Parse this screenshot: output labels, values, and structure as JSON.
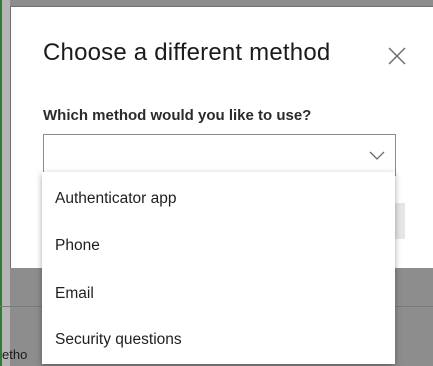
{
  "dialog": {
    "title": "Choose a different method",
    "close_icon": "close-icon",
    "prompt": "Which method would you like to use?",
    "select": {
      "value": "",
      "chevron_icon": "chevron-down-icon"
    },
    "options": [
      {
        "label": "Authenticator app"
      },
      {
        "label": "Phone"
      },
      {
        "label": "Email"
      },
      {
        "label": "Security questions"
      }
    ]
  },
  "background": {
    "partial_text": "etho"
  },
  "colors": {
    "overlay": "#8d8d8d",
    "dialog_bg": "#ffffff",
    "text": "#1b1b1b",
    "border": "#8a8a8a",
    "accent_green": "#2e7d32"
  }
}
